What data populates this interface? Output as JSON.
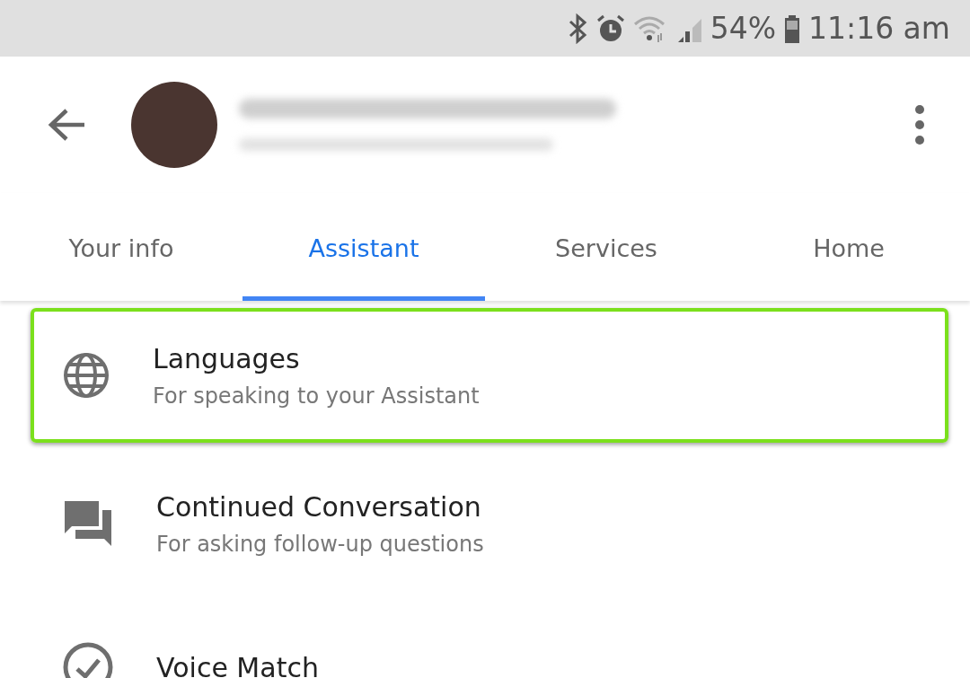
{
  "status_bar": {
    "battery_text": "54%",
    "time": "11:16 am"
  },
  "tabs": [
    {
      "label": "Your info",
      "selected": false
    },
    {
      "label": "Assistant",
      "selected": true
    },
    {
      "label": "Services",
      "selected": false
    },
    {
      "label": "Home",
      "selected": false
    }
  ],
  "settings": [
    {
      "kind": "globe",
      "title": "Languages",
      "subtitle": "For speaking to your Assistant",
      "highlighted": true
    },
    {
      "kind": "chat",
      "title": "Continued Conversation",
      "subtitle": "For asking follow-up questions",
      "highlighted": false
    },
    {
      "kind": "check",
      "title": "Voice Match",
      "highlighted": false
    }
  ]
}
